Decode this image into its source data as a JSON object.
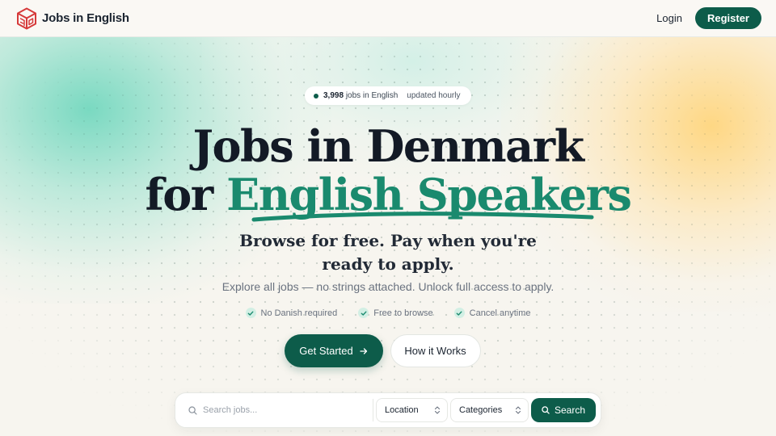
{
  "header": {
    "brand_name": "Jobs in English",
    "logo_icon": "cube-logo-icon",
    "login_label": "Login",
    "register_label": "Register"
  },
  "hero": {
    "badge": {
      "count": "3,998",
      "jobs_text": "jobs in English",
      "updated_text": "updated hourly"
    },
    "title_line1": "Jobs in Denmark",
    "title_line2_prefix": "for",
    "title_line2_accent": "English Speakers",
    "subhead_line1": "Browse for free. Pay when you're",
    "subhead_line2": "ready to apply.",
    "description": "Explore all jobs — no strings attached. Unlock full access to apply.",
    "perks": [
      {
        "label": "No Danish required",
        "icon": "check-icon"
      },
      {
        "label": "Free to browse",
        "icon": "check-icon"
      },
      {
        "label": "Cancel anytime",
        "icon": "check-icon"
      }
    ],
    "cta": {
      "primary_label": "Get Started",
      "primary_icon": "arrow-right-icon",
      "secondary_label": "How it Works"
    }
  },
  "search": {
    "placeholder": "Search jobs...",
    "location_label": "Location",
    "categories_label": "Categories",
    "button_label": "Search"
  },
  "colors": {
    "primary": "#0d5c4a",
    "accent": "#1a8a6e",
    "background": "#faf8f4",
    "glow_teal": "#6cd6bc",
    "glow_amber": "#ffd478"
  }
}
